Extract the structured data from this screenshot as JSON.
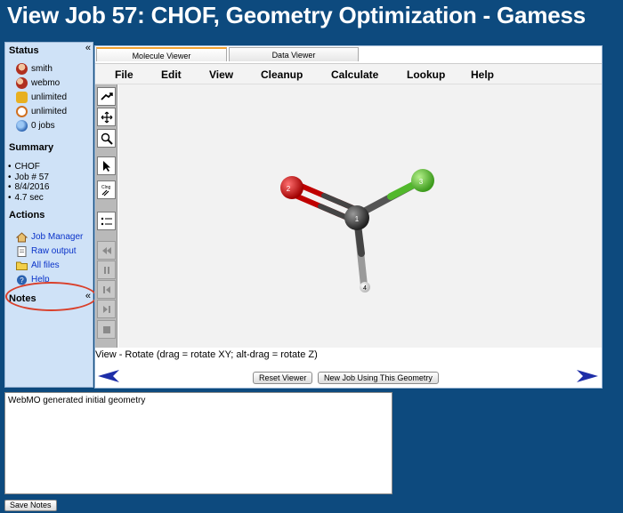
{
  "page": {
    "title": "View Job 57: CHOF, Geometry Optimization - Gamess"
  },
  "sidebar": {
    "collapse_glyph": "«",
    "status": {
      "title": "Status",
      "items": [
        {
          "icon": "user-icon",
          "label": "smith"
        },
        {
          "icon": "group-icon",
          "label": "webmo"
        },
        {
          "icon": "cpu-time-icon",
          "label": "unlimited"
        },
        {
          "icon": "clock-icon",
          "label": "unlimited"
        },
        {
          "icon": "jobs-icon",
          "label": "0 jobs"
        }
      ]
    },
    "summary": {
      "title": "Summary",
      "items": [
        "CHOF",
        "Job # 57",
        "8/4/2016",
        "4.7 sec"
      ]
    },
    "actions": {
      "title": "Actions",
      "items": [
        {
          "icon": "home-icon",
          "label": "Job Manager"
        },
        {
          "icon": "document-icon",
          "label": "Raw output"
        },
        {
          "icon": "folder-icon",
          "label": "All files"
        },
        {
          "icon": "help-icon",
          "label": "Help"
        }
      ]
    },
    "notes": {
      "title": "Notes"
    }
  },
  "viewer": {
    "tabs": [
      {
        "label": "Molecule Viewer",
        "active": true
      },
      {
        "label": "Data Viewer",
        "active": false
      }
    ],
    "menu": [
      "File",
      "Edit",
      "View",
      "Cleanup",
      "Calculate",
      "Lookup",
      "Help"
    ],
    "tools": [
      {
        "icon": "rotate-icon",
        "enabled": true
      },
      {
        "icon": "translate-icon",
        "enabled": true
      },
      {
        "icon": "zoom-icon",
        "enabled": true
      },
      {
        "icon": "select-arrow-icon",
        "enabled": true
      },
      {
        "icon": "clean-icon",
        "enabled": true
      },
      {
        "icon": "list-icon",
        "enabled": true
      },
      {
        "icon": "rewind-icon",
        "enabled": false
      },
      {
        "icon": "pause-icon",
        "enabled": false
      },
      {
        "icon": "step-back-icon",
        "enabled": false
      },
      {
        "icon": "step-forward-icon",
        "enabled": false
      },
      {
        "icon": "stop-icon",
        "enabled": false
      }
    ],
    "atoms": [
      {
        "index": "1",
        "element": "C",
        "color": "#3a3a3a"
      },
      {
        "index": "2",
        "element": "O",
        "color": "#e00000"
      },
      {
        "index": "3",
        "element": "F",
        "color": "#6cd43a"
      },
      {
        "index": "4",
        "element": "H",
        "color": "#f2f2f2"
      }
    ],
    "mode_text": "View - Rotate (drag = rotate XY; alt-drag = rotate Z)",
    "buttons": {
      "reset": "Reset Viewer",
      "new_job": "New Job Using This Geometry"
    }
  },
  "notes": {
    "text": "WebMO generated initial geometry",
    "save_label": "Save Notes"
  },
  "colors": {
    "page_bg": "#0d4a7e",
    "sidebar_bg": "#cfe2f7",
    "link": "#0a33c9",
    "highlight_circle": "#d9402b"
  }
}
